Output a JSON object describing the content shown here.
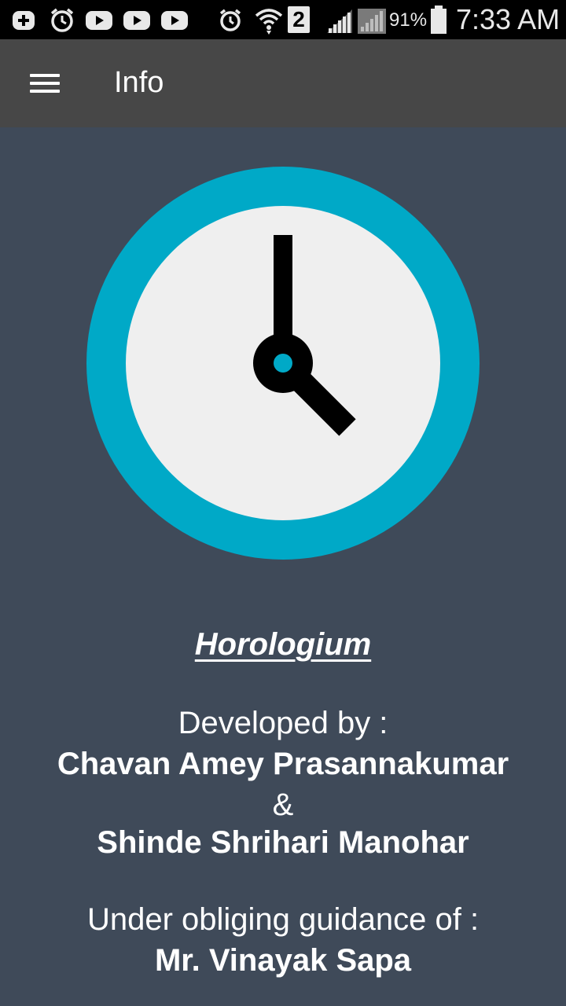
{
  "status_bar": {
    "icons": [
      "notification-plus-icon",
      "alarm-icon",
      "youtube-icon",
      "youtube-icon",
      "youtube-icon",
      "alarm-clock-icon",
      "wifi-icon",
      "sim-icon",
      "signal-icon",
      "signal-icon",
      "battery-icon"
    ],
    "sim_slot": "2",
    "battery_percent": "91%",
    "time": "7:33 AM"
  },
  "app_bar": {
    "menu_icon": "hamburger-menu-icon",
    "title": "Info"
  },
  "colors": {
    "status_bar_bg": "#000000",
    "app_bar_bg": "#474747",
    "content_bg": "#3f4a59",
    "clock_ring": "#00a9c7",
    "clock_face": "#efefef",
    "clock_hands": "#000000",
    "text": "#ffffff"
  },
  "logo": {
    "icon": "clock-icon"
  },
  "about": {
    "app_name": "Horologium",
    "developed_by_label": "Developed by :",
    "developer_1": "Chavan Amey Prasannakumar",
    "separator": "&",
    "developer_2": "Shinde Shrihari Manohar",
    "guidance_label": "Under obliging guidance of :",
    "mentor": "Mr. Vinayak Sapa"
  }
}
